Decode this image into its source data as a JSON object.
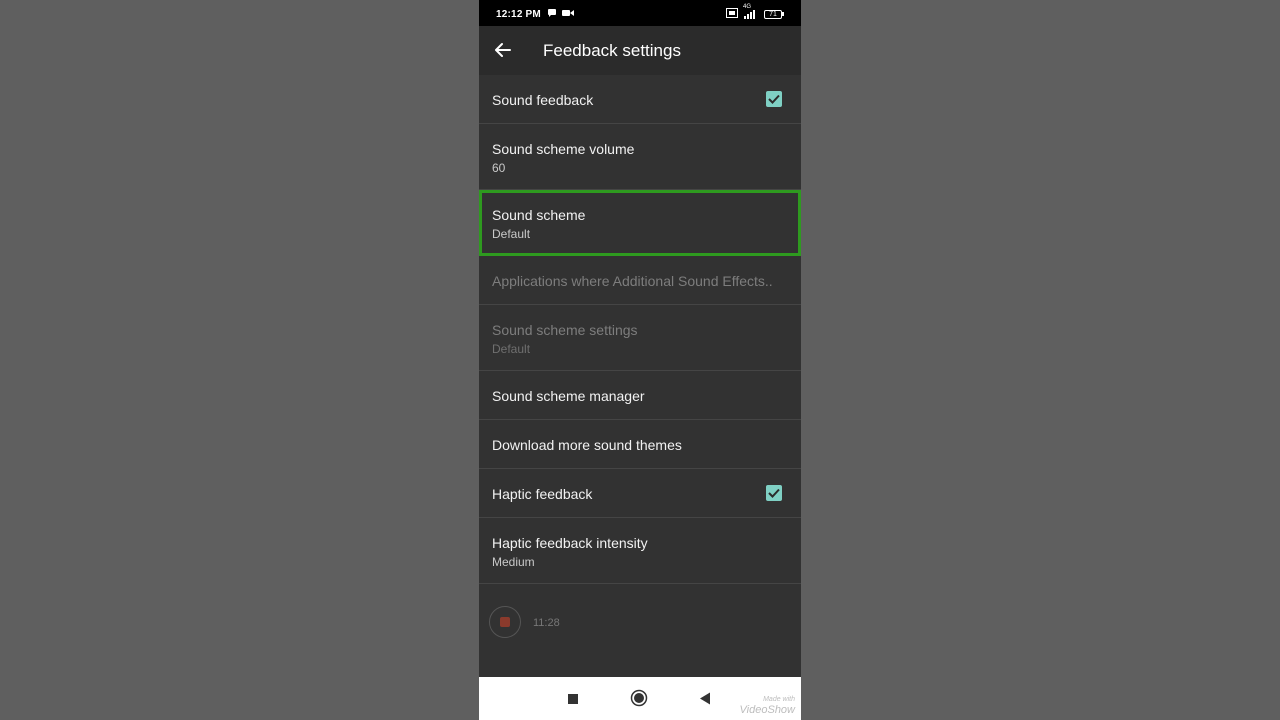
{
  "status_bar": {
    "time": "12:12 PM",
    "network": "4G",
    "battery": "71",
    "icons": [
      "chat-icon",
      "video-camera-icon",
      "volte-icon",
      "signal-icon",
      "battery-icon"
    ]
  },
  "toolbar": {
    "title": "Feedback settings",
    "back_icon": "arrow-left-icon"
  },
  "settings": {
    "sound_feedback": {
      "label": "Sound feedback",
      "checked": true
    },
    "sound_scheme_volume": {
      "label": "Sound scheme volume",
      "summary": "60"
    },
    "sound_scheme": {
      "label": "Sound scheme",
      "summary": "Default",
      "focused": true
    },
    "applications": {
      "label": "Applications where Additional Sound Effects..",
      "enabled": false
    },
    "sound_scheme_settings": {
      "label": "Sound scheme settings",
      "summary": "Default",
      "enabled": false
    },
    "sound_scheme_manager": {
      "label": "Sound scheme manager"
    },
    "download_themes": {
      "label": "Download more sound themes"
    },
    "haptic_feedback": {
      "label": "Haptic feedback",
      "checked": true
    },
    "haptic_intensity": {
      "label": "Haptic feedback intensity",
      "summary": "Medium"
    }
  },
  "recorder": {
    "time": "11:28"
  },
  "nav_bar": {
    "buttons": [
      "recents-square-icon",
      "home-circle-icon",
      "back-triangle-icon"
    ]
  },
  "watermark": {
    "line1": "Made with",
    "line2": "VideoShow"
  },
  "colors": {
    "background": "#5f5f5f",
    "screen": "#323232",
    "toolbar": "#2b2b2b",
    "checkbox": "#7fd0c4",
    "focus_outline": "#2e9a1f"
  }
}
